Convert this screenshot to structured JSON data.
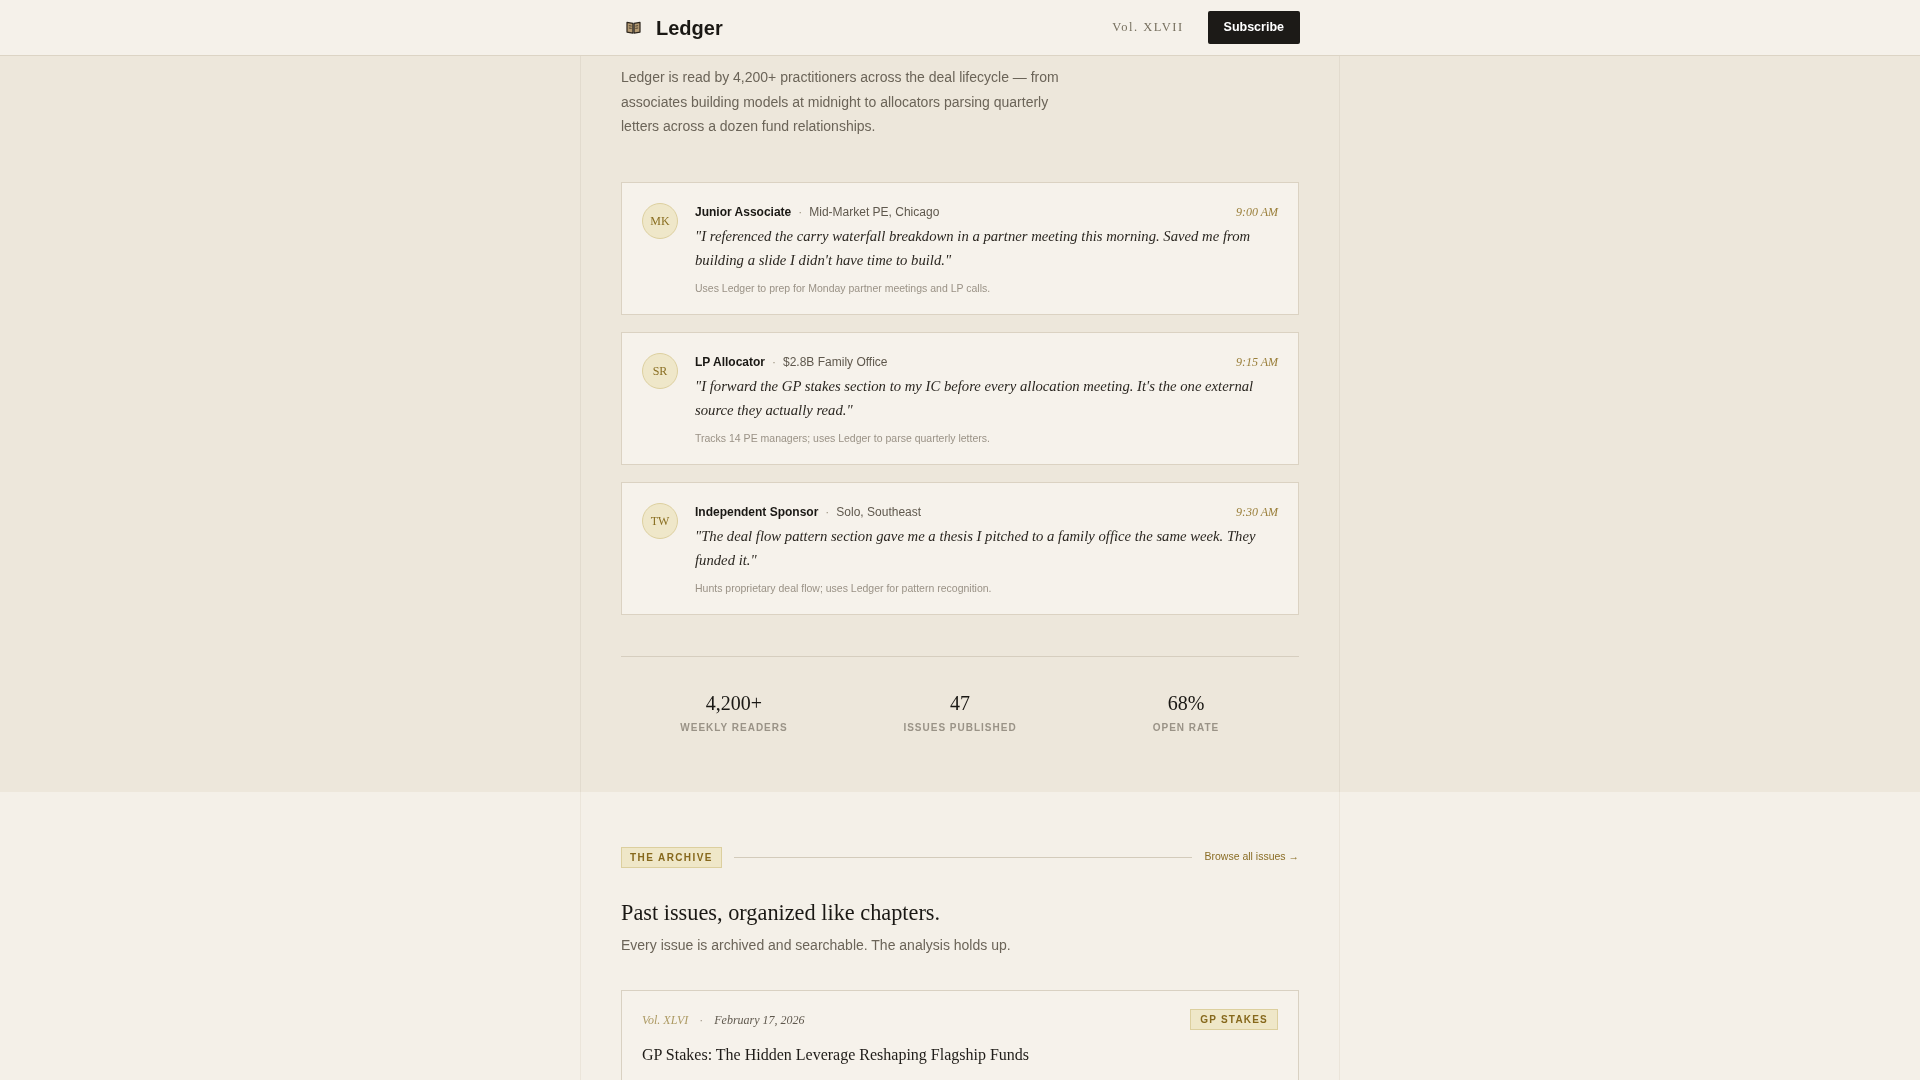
{
  "header": {
    "logo": "Ledger",
    "volume": "Vol. XLVII",
    "subscribe_button": "Subscribe"
  },
  "intro": {
    "text": "Ledger is read by 4,200+ practitioners across the deal lifecycle — from associates building models at midnight to allocators parsing quarterly letters across a dozen fund relationships."
  },
  "testimonials": [
    {
      "initials": "MK",
      "role": "Junior Associate",
      "separator": "·",
      "organization": "Mid-Market PE, Chicago",
      "time": "9:00 AM",
      "quote": "\"I referenced the carry waterfall breakdown in a partner meeting this morning. Saved me from building a slide I didn't have time to build.\"",
      "note": "Uses Ledger to prep for Monday partner meetings and LP calls."
    },
    {
      "initials": "SR",
      "role": "LP Allocator",
      "separator": "·",
      "organization": "$2.8B Family Office",
      "time": "9:15 AM",
      "quote": "\"I forward the GP stakes section to my IC before every allocation meeting. It's the one external source they actually read.\"",
      "note": "Tracks 14 PE managers; uses Ledger to parse quarterly letters."
    },
    {
      "initials": "TW",
      "role": "Independent Sponsor",
      "separator": "·",
      "organization": "Solo, Southeast",
      "time": "9:30 AM",
      "quote": "\"The deal flow pattern section gave me a thesis I pitched to a family office the same week. They funded it.\"",
      "note": "Hunts proprietary deal flow; uses Ledger for pattern recognition."
    }
  ],
  "stats": [
    {
      "value": "4,200+",
      "label": "WEEKLY READERS"
    },
    {
      "value": "47",
      "label": "ISSUES PUBLISHED"
    },
    {
      "value": "68%",
      "label": "OPEN RATE"
    }
  ],
  "archive": {
    "badge": "THE ARCHIVE",
    "browse_link": "Browse all issues →",
    "title": "Past issues, organized like chapters.",
    "subtitle": "Every issue is archived and searchable. The analysis holds up.",
    "issues": [
      {
        "volume": "Vol. XLVI",
        "separator": "·",
        "date": "February 17, 2026",
        "tag": "GP STAKES",
        "title": "GP Stakes: The Hidden Leverage Reshaping Flagship Funds"
      }
    ]
  }
}
